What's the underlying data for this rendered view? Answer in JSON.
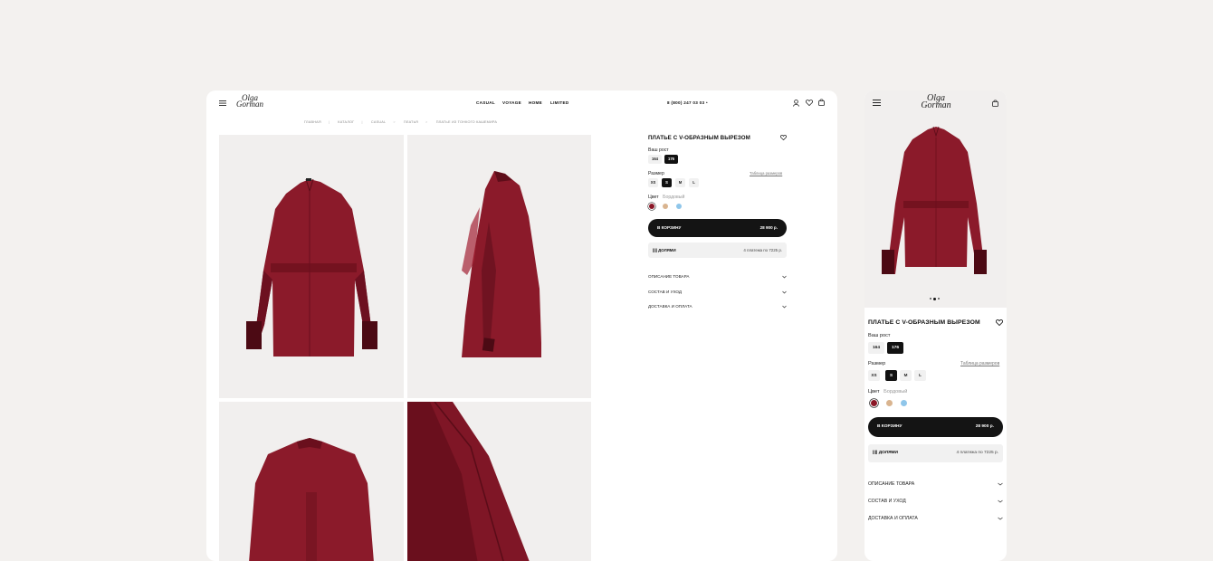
{
  "brand": {
    "logo_line1": "Olga",
    "logo_line2": "Gorman"
  },
  "header": {
    "nav": [
      "CASUAL",
      "VOYAGE",
      "HOME",
      "LIMITED"
    ],
    "phone": "8 (800) 247 03 03"
  },
  "breadcrumb": [
    "ГЛАВНАЯ",
    "КАТАЛОГ",
    "CASUAL",
    "ПЛАТЬЯ",
    "ПЛАТЬЕ ИЗ ТОНКОГО КАШЕМИРА"
  ],
  "product": {
    "title": "ПЛАТЬЕ С V-ОБРАЗНЫМ ВЫРЕЗОМ",
    "height_label": "Ваш рост",
    "heights": [
      "164",
      "176"
    ],
    "height_selected": 1,
    "size_label": "Размер",
    "size_chart_link": "Таблица размеров",
    "sizes": [
      "XS",
      "S",
      "M",
      "L"
    ],
    "size_selected": 1,
    "color_label": "Цвет",
    "color_value": "Бордовый",
    "colors": [
      "#8a1626",
      "#d9b48f",
      "#8fc6ea"
    ],
    "cart_label": "В КОРЗИНУ",
    "price": "28 900 р.",
    "dolyami_label": "|||| ДОЛЯМИ",
    "dolyami_text": "4 платежа по 7225 р.",
    "accordion": [
      "ОПИСАНИЕ ТОВАРА",
      "СОСТАВ И УХОД",
      "ДОСТАВКА И ОПЛАТА"
    ]
  },
  "colors": {
    "background": "#f3f1ef",
    "shirt": "#8b1a2a",
    "photo_bg": "#f1efee",
    "button": "#141414"
  }
}
